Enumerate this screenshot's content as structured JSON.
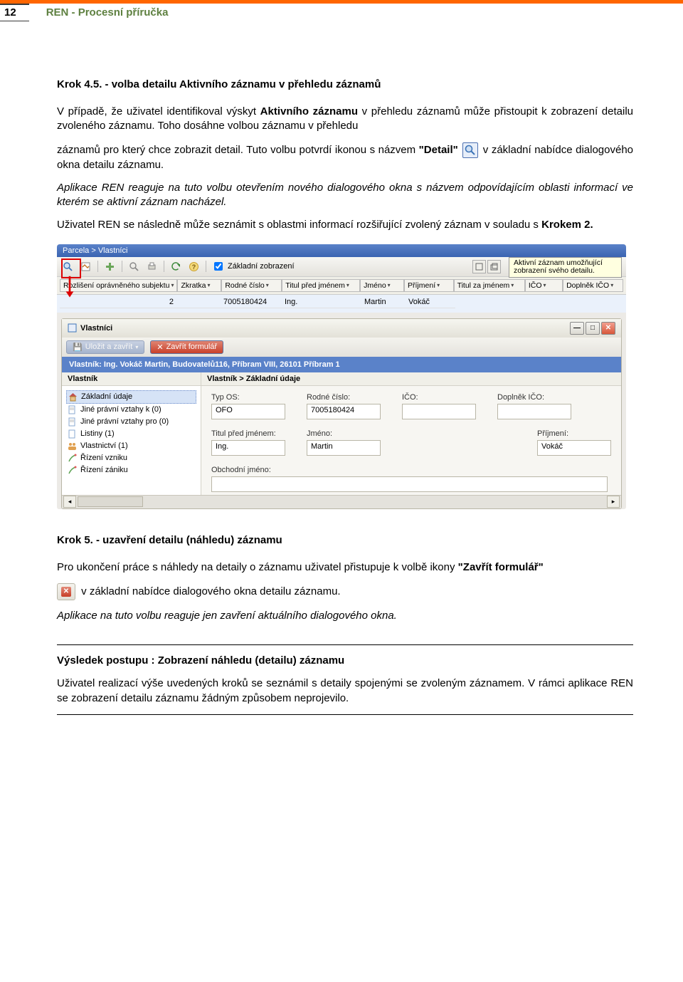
{
  "header": {
    "page_number": "12",
    "title": "REN - Procesní příručka"
  },
  "step45": {
    "title": "Krok 4.5. - volba detailu Aktivního záznamu  v přehledu záznamů",
    "para1_a": "V případě, že uživatel identifikoval výskyt ",
    "para1_b": "Aktivního záznamu",
    "para1_c": " v přehledu záznamů může přistoupit k zobrazení detailu zvoleného záznamu. Toho dosáhne volbou záznamu v přehledu",
    "para2_a": "záznamů pro který chce zobrazit detail. Tuto volbu potvrdí ikonou s názvem ",
    "para2_b": "\"Detail\"",
    "para2_c": " v základní nabídce dialogového okna detailu záznamu.",
    "para3": "Aplikace REN reaguje na tuto volbu otevřením nového dialogového okna s názvem odpovídajícím oblasti informací ve kterém se aktivní záznam nacházel.",
    "para4_a": "Uživatel REN se následně může seznámit s oblastmi informací rozšiřující zvolený záznam v souladu s ",
    "para4_b": "Krokem 2."
  },
  "screenshot": {
    "breadcrumb": "Parcela > Vlastníci",
    "toolbar_zobrazeni": "Základní zobrazení",
    "tooltip": "Aktivní záznam umožňující zobrazení svého detailu.",
    "grid_headers": [
      "Rozlišení oprávněného subjektu",
      "Zkratka",
      "Rodné číslo",
      "Titul před jménem",
      "Jméno",
      "Příjmení",
      "Titul za jménem",
      "IČO",
      "Doplněk IČO"
    ],
    "grid_data": {
      "rozliseni": "2",
      "zkratka": "",
      "rodne_cislo": "7005180424",
      "titul_pred": "Ing.",
      "jmeno": "Martin",
      "prijmeni": "Vokáč"
    },
    "sub_title": "Vlastníci",
    "btn_ulozit": "Uložit a zavřít",
    "btn_zavrit": "Zavřít formulář",
    "info_bar": "Vlastník: Ing. Vokáč Martin, Budovatelů116, Příbram VIII, 26101 Příbram 1",
    "tree_title": "Vlastník",
    "right_title": "Vlastník > Základní údaje",
    "tree": [
      "Základní údaje",
      "Jiné právní vztahy k  (0)",
      "Jiné právní vztahy pro  (0)",
      "Listiny  (1)",
      "Vlastnictví  (1)",
      "Řízení vzniku",
      "Řízení zániku"
    ],
    "form": {
      "typ_os_label": "Typ OS:",
      "typ_os_value": "OFO",
      "rodne_cislo_label": "Rodné číslo:",
      "rodne_cislo_value": "7005180424",
      "ico_label": "IČO:",
      "ico_value": "",
      "doplnek_ico_label": "Doplněk IČO:",
      "doplnek_ico_value": "",
      "titul_pred_label": "Titul před jménem:",
      "titul_pred_value": "Ing.",
      "jmeno_label": "Jméno:",
      "jmeno_value": "Martin",
      "prijmeni_label": "Příjmení:",
      "prijmeni_value": "Vokáč",
      "obchodni_label": "Obchodní jméno:",
      "obchodni_value": ""
    }
  },
  "step5": {
    "title": "Krok 5. - uzavření detailu (náhledu) záznamu",
    "para1_a": "Pro ukončení práce s náhledy na detaily o záznamu uživatel přistupuje k volbě ikony ",
    "para1_b": "\"Zavřít formulář\"",
    "para2": " v základní nabídce dialogového okna detailu záznamu.",
    "para3": "Aplikace na tuto volbu reaguje jen zavření aktuálního dialogového okna."
  },
  "result": {
    "title": "Výsledek postupu : Zobrazení náhledu (detailu) záznamu",
    "para": "Uživatel realizací výše uvedených kroků se seznámil s detaily spojenými se zvoleným záznamem.  V rámci aplikace REN se zobrazení detailu záznamu žádným způsobem neprojevilo."
  }
}
